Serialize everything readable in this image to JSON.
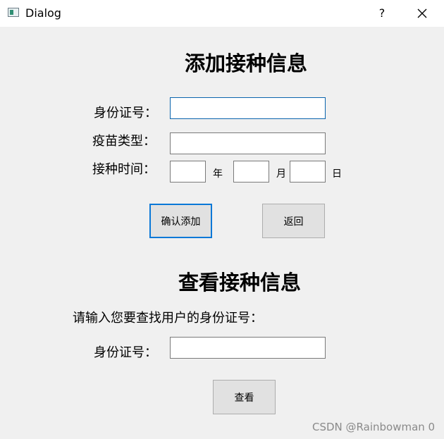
{
  "window": {
    "title": "Dialog",
    "help_label": "?"
  },
  "add_section": {
    "heading": "添加接种信息",
    "id_label": "身份证号：",
    "vaccine_label": "疫苗类型：",
    "time_label": "接种时间：",
    "year_unit": "年",
    "month_unit": "月",
    "day_unit": "日",
    "confirm_label": "确认添加",
    "back_label": "返回"
  },
  "query_section": {
    "heading": "查看接种信息",
    "prompt": "请输入您要查找用户的身份证号：",
    "id_label": "身份证号：",
    "view_label": "查看"
  },
  "watermark": "CSDN @Rainbowman 0"
}
